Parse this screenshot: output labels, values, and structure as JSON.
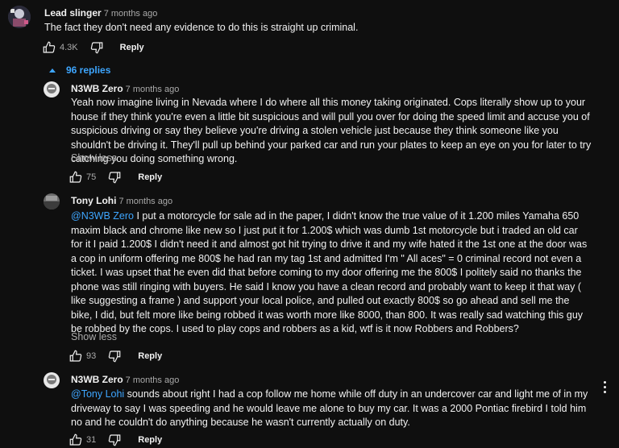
{
  "comment": {
    "author": "Lead slinger",
    "time": "7 months ago",
    "text": "The fact they don't need any evidence to do this is straight up criminal.",
    "likes": "4.3K",
    "reply_label": "Reply"
  },
  "replies_toggle": {
    "label": "96 replies"
  },
  "replies": [
    {
      "author": "N3WB Zero",
      "time": "7 months ago",
      "text": "Yeah now imagine living in Nevada where I do where all this money taking originated. Cops literally show up to your house if they think you're even a little bit suspicious and will pull you over for doing the speed limit and accuse you of suspicious driving or say they believe you're driving a stolen vehicle just because they think someone like you shouldn't be driving it. They'll pull up behind your parked car and run your plates to keep an eye on you for later to try catching you doing something wrong.",
      "show_less": "Show less",
      "likes": "75",
      "reply_label": "Reply"
    },
    {
      "author": "Tony Lohi",
      "time": "7 months ago",
      "mention": "@N3WB Zero",
      "text": " I put a motorcycle for sale ad in the paper, I didn't know the true value of it 1.200 miles Yamaha 650 maxim black and chrome like new so I just put it for 1.200$ which was dumb 1st motorcycle but i traded an old car for it I paid 1.200$  I didn't need it and almost got hit trying to drive it and my wife hated it the 1st one at the door was a cop in uniform offering me 800$ he had ran my tag 1st and admitted I'm \" All aces\" = 0 criminal record not even a ticket. I was upset that he even did that before coming to my door offering me the 800$ I politely said no thanks the phone was still ringing with buyers. He said I know you have a clean record and probably want to keep it that way ( like suggesting a frame ) and support your local police, and pulled out exactly 800$ so go ahead and sell me the bike, I did, but felt more like being robbed it was worth more like 8000, than 800. It was really sad watching this guy be robbed by the cops. I used to play cops and robbers as a kid, wtf is it now Robbers and Robbers?",
      "show_less": "Show less",
      "likes": "93",
      "reply_label": "Reply"
    },
    {
      "author": "N3WB Zero",
      "time": "7 months ago",
      "mention": "@Tony Lohi",
      "text": "  sounds about right I had a cop follow me home while off duty in an undercover car and light me of in my driveway to say I was speeding and he would leave me alone to buy my car. It was a 2000 Pontiac firebird I told him no and he couldn't do anything because he wasn't currently actually on duty.",
      "likes": "31",
      "reply_label": "Reply"
    }
  ],
  "colors": {
    "background": "#0f0f0f",
    "text": "#f1f1f1",
    "muted": "#aaaaaa",
    "link": "#3ea6ff"
  },
  "icons": [
    "thumbs-up-icon",
    "thumbs-down-icon",
    "chevron-up-icon",
    "more-vert-icon"
  ]
}
